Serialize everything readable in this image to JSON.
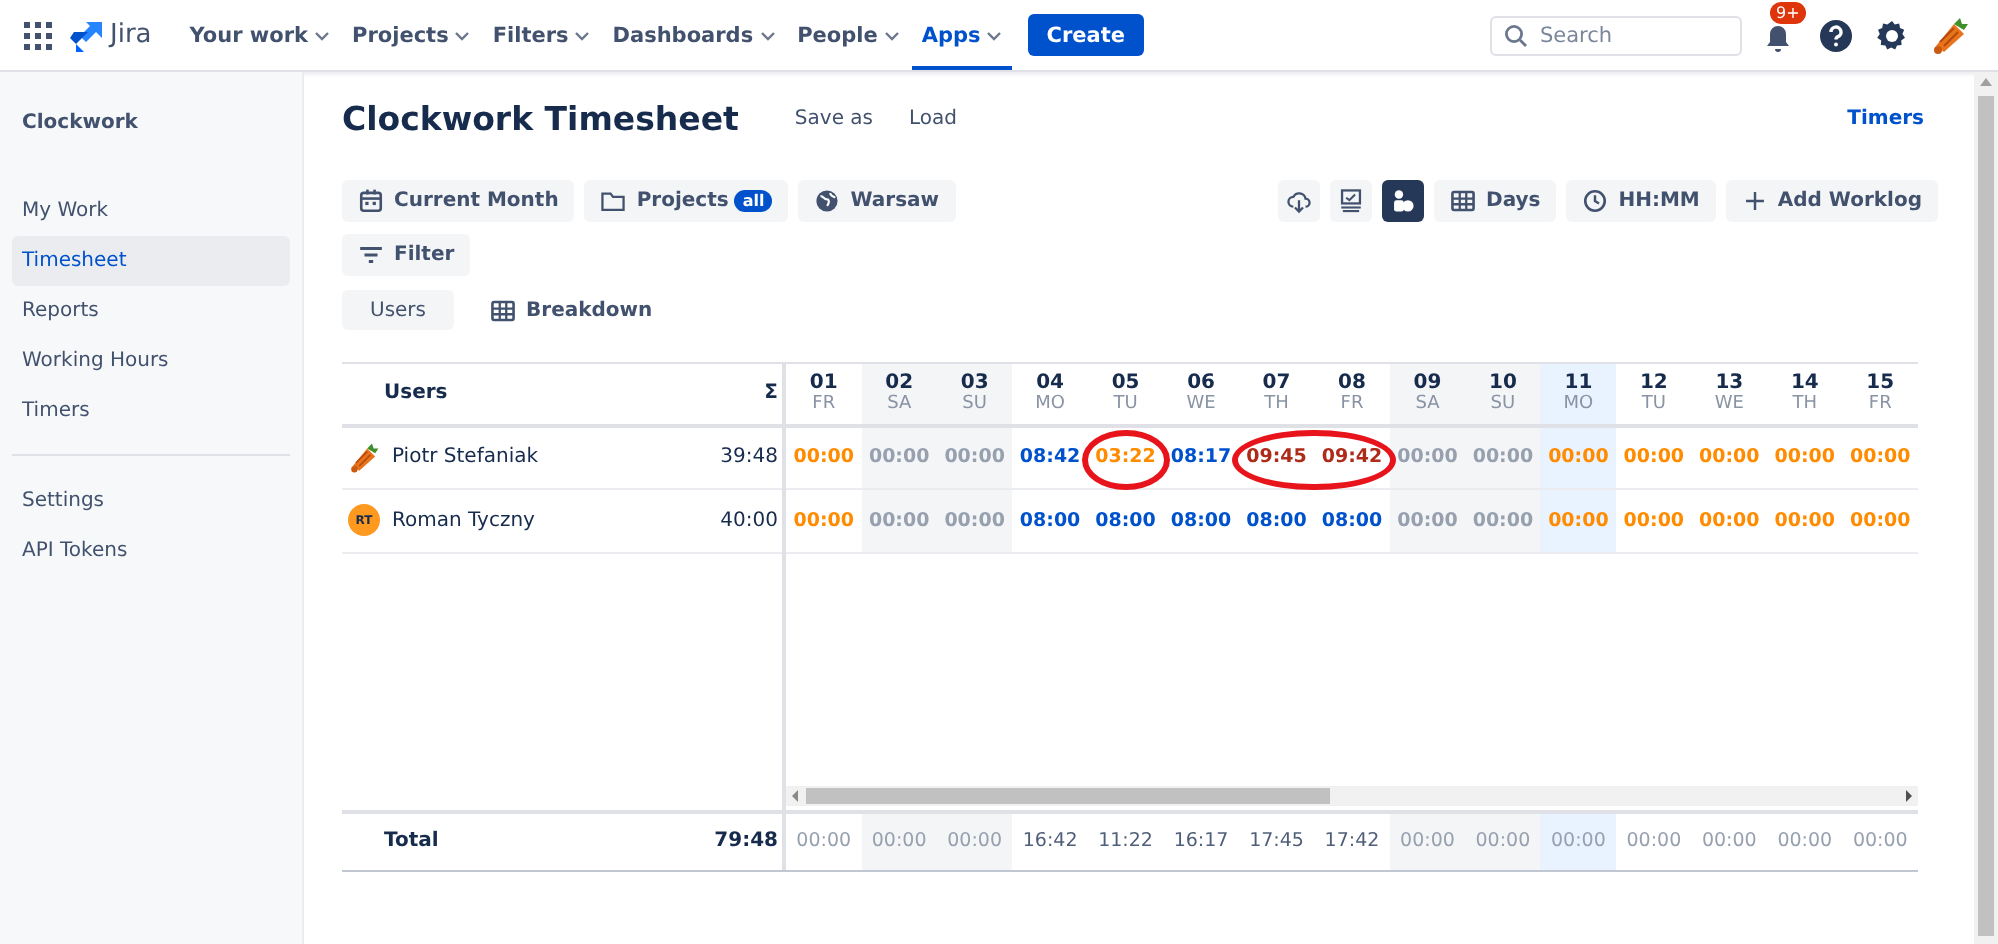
{
  "nav": {
    "product": "Jira",
    "menus": [
      {
        "label": "Your work",
        "selected": false
      },
      {
        "label": "Projects",
        "selected": false
      },
      {
        "label": "Filters",
        "selected": false
      },
      {
        "label": "Dashboards",
        "selected": false
      },
      {
        "label": "People",
        "selected": false
      },
      {
        "label": "Apps",
        "selected": true
      }
    ],
    "create": "Create",
    "search": {
      "placeholder": "Search"
    },
    "notifications": "9+"
  },
  "sidebar": {
    "title": "Clockwork",
    "groups": [
      [
        {
          "label": "My Work",
          "selected": false
        },
        {
          "label": "Timesheet",
          "selected": true
        },
        {
          "label": "Reports",
          "selected": false
        },
        {
          "label": "Working Hours",
          "selected": false
        },
        {
          "label": "Timers",
          "selected": false
        }
      ],
      [
        {
          "label": "Settings",
          "selected": false
        },
        {
          "label": "API Tokens",
          "selected": false
        }
      ]
    ]
  },
  "header": {
    "title": "Clockwork Timesheet",
    "actions": [
      "Save as",
      "Load"
    ],
    "link": "Timers"
  },
  "toolbar": {
    "left": [
      {
        "kind": "calendar",
        "label": "Current Month"
      },
      {
        "kind": "folder",
        "label": "Projects",
        "badge": "all"
      },
      {
        "kind": "globe",
        "label": "Warsaw"
      }
    ],
    "icons": [
      {
        "kind": "cloud",
        "selected": false
      },
      {
        "kind": "monitor",
        "selected": false
      },
      {
        "kind": "group",
        "selected": true
      }
    ],
    "right": [
      {
        "kind": "grid",
        "label": "Days"
      },
      {
        "kind": "clock",
        "label": "HH:MM"
      },
      {
        "kind": "plus",
        "label": "Add Worklog"
      }
    ],
    "filter": "Filter",
    "views": [
      {
        "kind": "plain",
        "label": "Users",
        "selected": true
      },
      {
        "kind": "grid",
        "label": "Breakdown",
        "selected": false
      }
    ]
  },
  "table": {
    "users_header": "Users",
    "sum_header": "Σ",
    "days": [
      {
        "num": "01",
        "dow": "FR",
        "kind": "workday"
      },
      {
        "num": "02",
        "dow": "SA",
        "kind": "weekend"
      },
      {
        "num": "03",
        "dow": "SU",
        "kind": "weekend"
      },
      {
        "num": "04",
        "dow": "MO",
        "kind": "workday"
      },
      {
        "num": "05",
        "dow": "TU",
        "kind": "workday"
      },
      {
        "num": "06",
        "dow": "WE",
        "kind": "workday"
      },
      {
        "num": "07",
        "dow": "TH",
        "kind": "workday"
      },
      {
        "num": "08",
        "dow": "FR",
        "kind": "workday"
      },
      {
        "num": "09",
        "dow": "SA",
        "kind": "weekend"
      },
      {
        "num": "10",
        "dow": "SU",
        "kind": "weekend"
      },
      {
        "num": "11",
        "dow": "MO",
        "kind": "today"
      },
      {
        "num": "12",
        "dow": "TU",
        "kind": "workday"
      },
      {
        "num": "13",
        "dow": "WE",
        "kind": "workday"
      },
      {
        "num": "14",
        "dow": "TH",
        "kind": "workday"
      },
      {
        "num": "15",
        "dow": "FR",
        "kind": "workday"
      }
    ],
    "rows": [
      {
        "name": "Piotr Stefaniak",
        "total": "39:48",
        "cells": [
          {
            "value": "00:00",
            "color": "#ff8b00",
            "circled": false
          },
          {
            "value": "00:00",
            "color": "#97a0af",
            "circled": false
          },
          {
            "value": "00:00",
            "color": "#97a0af",
            "circled": false
          },
          {
            "value": "08:42",
            "color": "#0052cc",
            "circled": false
          },
          {
            "value": "03:22",
            "color": "#ff8b00",
            "circled": true
          },
          {
            "value": "08:17",
            "color": "#0052cc",
            "circled": false
          },
          {
            "value": "09:45",
            "color": "#ae2a19",
            "circled": true
          },
          {
            "value": "09:42",
            "color": "#ae2a19",
            "circled": true
          },
          {
            "value": "00:00",
            "color": "#97a0af",
            "circled": false
          },
          {
            "value": "00:00",
            "color": "#97a0af",
            "circled": false
          },
          {
            "value": "00:00",
            "color": "#ff8b00",
            "circled": false
          },
          {
            "value": "00:00",
            "color": "#ff8b00",
            "circled": false
          },
          {
            "value": "00:00",
            "color": "#ff8b00",
            "circled": false
          },
          {
            "value": "00:00",
            "color": "#ff8b00",
            "circled": false
          },
          {
            "value": "00:00",
            "color": "#ff8b00",
            "circled": false
          }
        ]
      },
      {
        "name": "Roman Tyczny",
        "avatar": {
          "kind": "initials",
          "text": "RT"
        },
        "total": "40:00",
        "cells": [
          {
            "value": "00:00",
            "color": "#ff8b00",
            "circled": false
          },
          {
            "value": "00:00",
            "color": "#97a0af",
            "circled": false
          },
          {
            "value": "00:00",
            "color": "#97a0af",
            "circled": false
          },
          {
            "value": "08:00",
            "color": "#0052cc",
            "circled": false
          },
          {
            "value": "08:00",
            "color": "#0052cc",
            "circled": false
          },
          {
            "value": "08:00",
            "color": "#0052cc",
            "circled": false
          },
          {
            "value": "08:00",
            "color": "#0052cc",
            "circled": false
          },
          {
            "value": "08:00",
            "color": "#0052cc",
            "circled": false
          },
          {
            "value": "00:00",
            "color": "#97a0af",
            "circled": false
          },
          {
            "value": "00:00",
            "color": "#97a0af",
            "circled": false
          },
          {
            "value": "00:00",
            "color": "#ff8b00",
            "circled": false
          },
          {
            "value": "00:00",
            "color": "#ff8b00",
            "circled": false
          },
          {
            "value": "00:00",
            "color": "#ff8b00",
            "circled": false
          },
          {
            "value": "00:00",
            "color": "#ff8b00",
            "circled": false
          },
          {
            "value": "00:00",
            "color": "#ff8b00",
            "circled": false
          }
        ]
      }
    ],
    "total": {
      "label": "Total",
      "value": "79:48",
      "cells": [
        {
          "value": "00:00",
          "muted": true
        },
        {
          "value": "00:00",
          "muted": true
        },
        {
          "value": "00:00",
          "muted": true
        },
        {
          "value": "16:42",
          "muted": false
        },
        {
          "value": "11:22",
          "muted": false
        },
        {
          "value": "16:17",
          "muted": false
        },
        {
          "value": "17:45",
          "muted": false
        },
        {
          "value": "17:42",
          "muted": false
        },
        {
          "value": "00:00",
          "muted": true
        },
        {
          "value": "00:00",
          "muted": true
        },
        {
          "value": "00:00",
          "muted": true
        },
        {
          "value": "00:00",
          "muted": true
        },
        {
          "value": "00:00",
          "muted": true
        },
        {
          "value": "00:00",
          "muted": true
        },
        {
          "value": "00:00",
          "muted": true
        }
      ]
    }
  }
}
